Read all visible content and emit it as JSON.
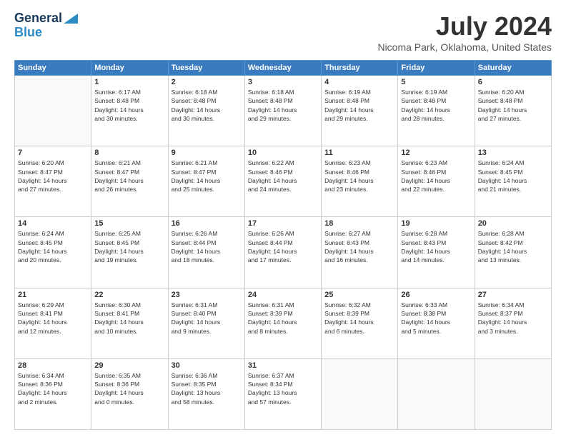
{
  "logo": {
    "general": "General",
    "blue": "Blue"
  },
  "title": "July 2024",
  "location": "Nicoma Park, Oklahoma, United States",
  "days_of_week": [
    "Sunday",
    "Monday",
    "Tuesday",
    "Wednesday",
    "Thursday",
    "Friday",
    "Saturday"
  ],
  "weeks": [
    [
      {
        "day": "",
        "info": ""
      },
      {
        "day": "1",
        "info": "Sunrise: 6:17 AM\nSunset: 8:48 PM\nDaylight: 14 hours\nand 30 minutes."
      },
      {
        "day": "2",
        "info": "Sunrise: 6:18 AM\nSunset: 8:48 PM\nDaylight: 14 hours\nand 30 minutes."
      },
      {
        "day": "3",
        "info": "Sunrise: 6:18 AM\nSunset: 8:48 PM\nDaylight: 14 hours\nand 29 minutes."
      },
      {
        "day": "4",
        "info": "Sunrise: 6:19 AM\nSunset: 8:48 PM\nDaylight: 14 hours\nand 29 minutes."
      },
      {
        "day": "5",
        "info": "Sunrise: 6:19 AM\nSunset: 8:48 PM\nDaylight: 14 hours\nand 28 minutes."
      },
      {
        "day": "6",
        "info": "Sunrise: 6:20 AM\nSunset: 8:48 PM\nDaylight: 14 hours\nand 27 minutes."
      }
    ],
    [
      {
        "day": "7",
        "info": "Sunrise: 6:20 AM\nSunset: 8:47 PM\nDaylight: 14 hours\nand 27 minutes."
      },
      {
        "day": "8",
        "info": "Sunrise: 6:21 AM\nSunset: 8:47 PM\nDaylight: 14 hours\nand 26 minutes."
      },
      {
        "day": "9",
        "info": "Sunrise: 6:21 AM\nSunset: 8:47 PM\nDaylight: 14 hours\nand 25 minutes."
      },
      {
        "day": "10",
        "info": "Sunrise: 6:22 AM\nSunset: 8:46 PM\nDaylight: 14 hours\nand 24 minutes."
      },
      {
        "day": "11",
        "info": "Sunrise: 6:23 AM\nSunset: 8:46 PM\nDaylight: 14 hours\nand 23 minutes."
      },
      {
        "day": "12",
        "info": "Sunrise: 6:23 AM\nSunset: 8:46 PM\nDaylight: 14 hours\nand 22 minutes."
      },
      {
        "day": "13",
        "info": "Sunrise: 6:24 AM\nSunset: 8:45 PM\nDaylight: 14 hours\nand 21 minutes."
      }
    ],
    [
      {
        "day": "14",
        "info": "Sunrise: 6:24 AM\nSunset: 8:45 PM\nDaylight: 14 hours\nand 20 minutes."
      },
      {
        "day": "15",
        "info": "Sunrise: 6:25 AM\nSunset: 8:45 PM\nDaylight: 14 hours\nand 19 minutes."
      },
      {
        "day": "16",
        "info": "Sunrise: 6:26 AM\nSunset: 8:44 PM\nDaylight: 14 hours\nand 18 minutes."
      },
      {
        "day": "17",
        "info": "Sunrise: 6:26 AM\nSunset: 8:44 PM\nDaylight: 14 hours\nand 17 minutes."
      },
      {
        "day": "18",
        "info": "Sunrise: 6:27 AM\nSunset: 8:43 PM\nDaylight: 14 hours\nand 16 minutes."
      },
      {
        "day": "19",
        "info": "Sunrise: 6:28 AM\nSunset: 8:43 PM\nDaylight: 14 hours\nand 14 minutes."
      },
      {
        "day": "20",
        "info": "Sunrise: 6:28 AM\nSunset: 8:42 PM\nDaylight: 14 hours\nand 13 minutes."
      }
    ],
    [
      {
        "day": "21",
        "info": "Sunrise: 6:29 AM\nSunset: 8:41 PM\nDaylight: 14 hours\nand 12 minutes."
      },
      {
        "day": "22",
        "info": "Sunrise: 6:30 AM\nSunset: 8:41 PM\nDaylight: 14 hours\nand 10 minutes."
      },
      {
        "day": "23",
        "info": "Sunrise: 6:31 AM\nSunset: 8:40 PM\nDaylight: 14 hours\nand 9 minutes."
      },
      {
        "day": "24",
        "info": "Sunrise: 6:31 AM\nSunset: 8:39 PM\nDaylight: 14 hours\nand 8 minutes."
      },
      {
        "day": "25",
        "info": "Sunrise: 6:32 AM\nSunset: 8:39 PM\nDaylight: 14 hours\nand 6 minutes."
      },
      {
        "day": "26",
        "info": "Sunrise: 6:33 AM\nSunset: 8:38 PM\nDaylight: 14 hours\nand 5 minutes."
      },
      {
        "day": "27",
        "info": "Sunrise: 6:34 AM\nSunset: 8:37 PM\nDaylight: 14 hours\nand 3 minutes."
      }
    ],
    [
      {
        "day": "28",
        "info": "Sunrise: 6:34 AM\nSunset: 8:36 PM\nDaylight: 14 hours\nand 2 minutes."
      },
      {
        "day": "29",
        "info": "Sunrise: 6:35 AM\nSunset: 8:36 PM\nDaylight: 14 hours\nand 0 minutes."
      },
      {
        "day": "30",
        "info": "Sunrise: 6:36 AM\nSunset: 8:35 PM\nDaylight: 13 hours\nand 58 minutes."
      },
      {
        "day": "31",
        "info": "Sunrise: 6:37 AM\nSunset: 8:34 PM\nDaylight: 13 hours\nand 57 minutes."
      },
      {
        "day": "",
        "info": ""
      },
      {
        "day": "",
        "info": ""
      },
      {
        "day": "",
        "info": ""
      }
    ]
  ]
}
